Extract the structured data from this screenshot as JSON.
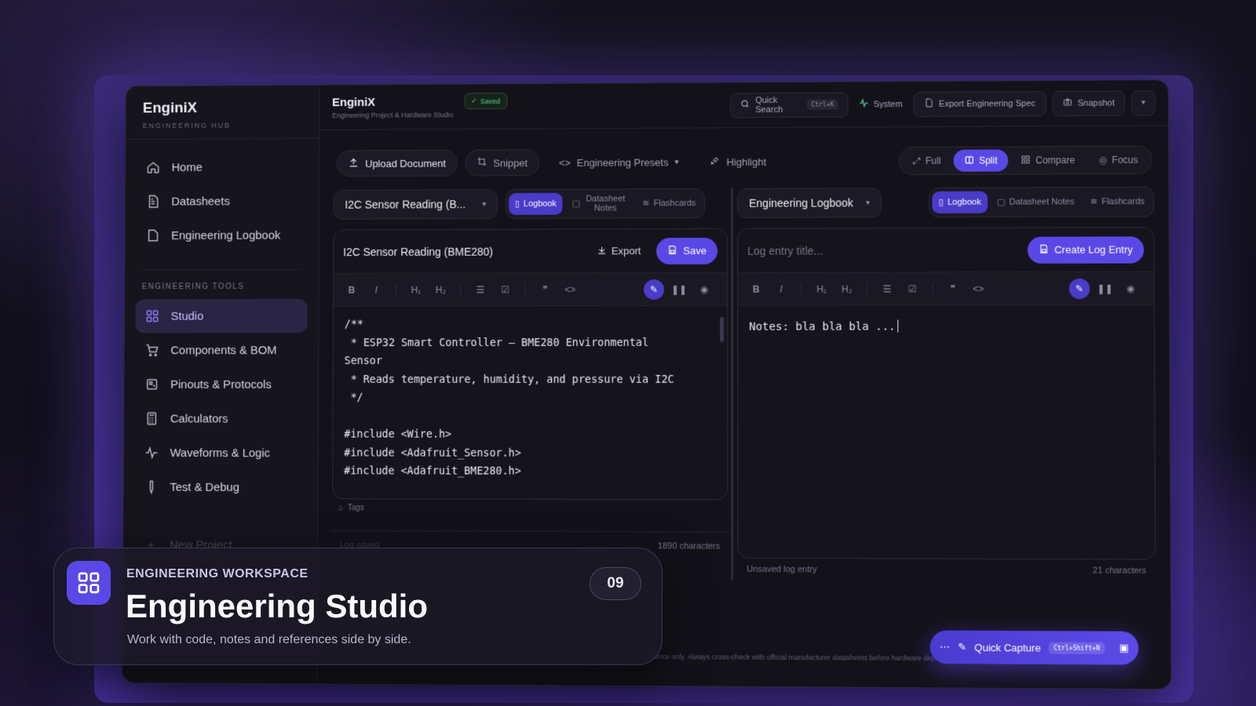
{
  "sidebar": {
    "brand": "EnginiX",
    "brand_sub": "ENGINEERING HUB",
    "nav": [
      {
        "label": "Home",
        "icon": "home-icon"
      },
      {
        "label": "Datasheets",
        "icon": "document-icon"
      },
      {
        "label": "Engineering Logbook",
        "icon": "notebook-icon"
      }
    ],
    "section_label": "ENGINEERING TOOLS",
    "tools": [
      {
        "label": "Studio",
        "icon": "grid-icon",
        "active": true
      },
      {
        "label": "Components & BOM",
        "icon": "cart-icon"
      },
      {
        "label": "Pinouts & Protocols",
        "icon": "chip-icon"
      },
      {
        "label": "Calculators",
        "icon": "calculator-icon"
      },
      {
        "label": "Waveforms & Logic",
        "icon": "waveform-icon"
      },
      {
        "label": "Test & Debug",
        "icon": "probe-icon"
      }
    ],
    "faded_item": "New Project"
  },
  "topbar": {
    "title": "EnginiX",
    "subtitle": "Engineering Project & Hardware Studio",
    "saved": "Saved",
    "search": "Quick Search",
    "search_kbd": "Ctrl+K",
    "system": "System",
    "export_spec": "Export Engineering Spec",
    "snapshot": "Snapshot"
  },
  "toolbar": {
    "upload": "Upload Document",
    "snippet": "Snippet",
    "presets": "Engineering Presets",
    "highlight": "Highlight",
    "views": [
      "Full",
      "Split",
      "Compare",
      "Focus"
    ],
    "active_view": "Split"
  },
  "left_pane": {
    "doc_select": "I2C Sensor Reading (B...",
    "tabs": [
      "Logbook",
      "Datasheet Notes",
      "Flashcards"
    ],
    "card_title": "I2C Sensor Reading (BME280)",
    "export": "Export",
    "save": "Save",
    "code": "/**\n * ESP32 Smart Controller – BME280 Environmental\nSensor\n * Reads temperature, humidity, and pressure via I2C\n */\n\n#include <Wire.h>\n#include <Adafruit_Sensor.h>\n#include <Adafruit_BME280.h>",
    "tags": "Tags",
    "status_left": "Log saved",
    "status_right": "1890 characters"
  },
  "right_pane": {
    "doc_select": "Engineering Logbook",
    "tabs": [
      "Logbook",
      "Datasheet Notes",
      "Flashcards"
    ],
    "title_placeholder": "Log entry title...",
    "create": "Create Log Entry",
    "note": "Notes: bla bla bla ...",
    "status_left": "Unsaved log entry",
    "status_right": "21 characters"
  },
  "quick_capture": {
    "label": "Quick Capture",
    "kbd": "Ctrl+Shift+N"
  },
  "footnote": "ference only. Always cross-check with official manufacturer datasheets before hardware deployment.",
  "caption": {
    "eyebrow": "ENGINEERING WORKSPACE",
    "title": "Engineering Studio",
    "subtitle": "Work with code, notes and references side by side.",
    "number": "09"
  },
  "colors": {
    "accent": "#5a48e6",
    "success": "#4fd18b",
    "background": "#141219"
  }
}
